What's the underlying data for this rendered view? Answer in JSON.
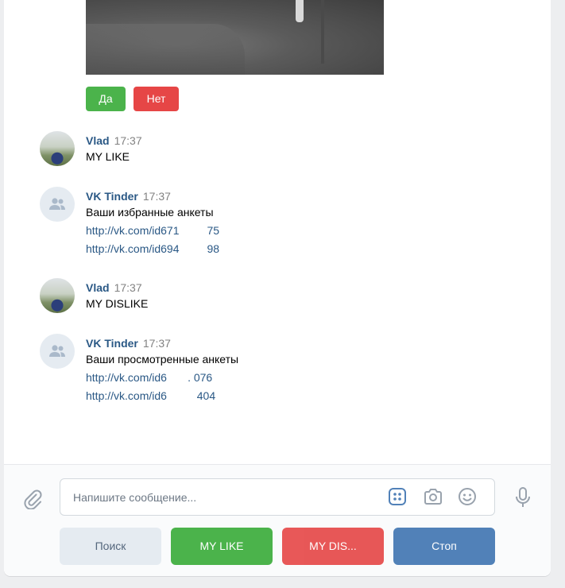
{
  "inline_buttons": {
    "yes": "Да",
    "no": "Нет"
  },
  "messages": [
    {
      "author": "Vlad",
      "time": "17:37",
      "text": "MY LIKE",
      "links": []
    },
    {
      "author": "VK Tinder",
      "time": "17:37",
      "text": "Ваши избранные анкеты",
      "links": [
        "http://vk.com/id671         75",
        "http://vk.com/id694         98"
      ]
    },
    {
      "author": "Vlad",
      "time": "17:37",
      "text": "MY DISLIKE",
      "links": []
    },
    {
      "author": "VK Tinder",
      "time": "17:37",
      "text": "Ваши просмотренные анкеты",
      "links": [
        "http://vk.com/id6       . 076",
        "http://vk.com/id6          404"
      ]
    }
  ],
  "composer": {
    "placeholder": "Напишите сообщение..."
  },
  "keyboard": {
    "search": "Поиск",
    "my_like": "MY LIKE",
    "my_dislike": "MY DIS...",
    "stop": "Стоп"
  },
  "icons": {
    "attach": "paperclip-icon",
    "apps": "apps-grid-icon",
    "camera": "camera-icon",
    "emoji": "smile-icon",
    "mic": "microphone-icon",
    "group": "users-icon"
  },
  "colors": {
    "positive": "#4bb34b",
    "negative": "#e64646",
    "primary": "#5181b8",
    "link": "#2a5885"
  }
}
